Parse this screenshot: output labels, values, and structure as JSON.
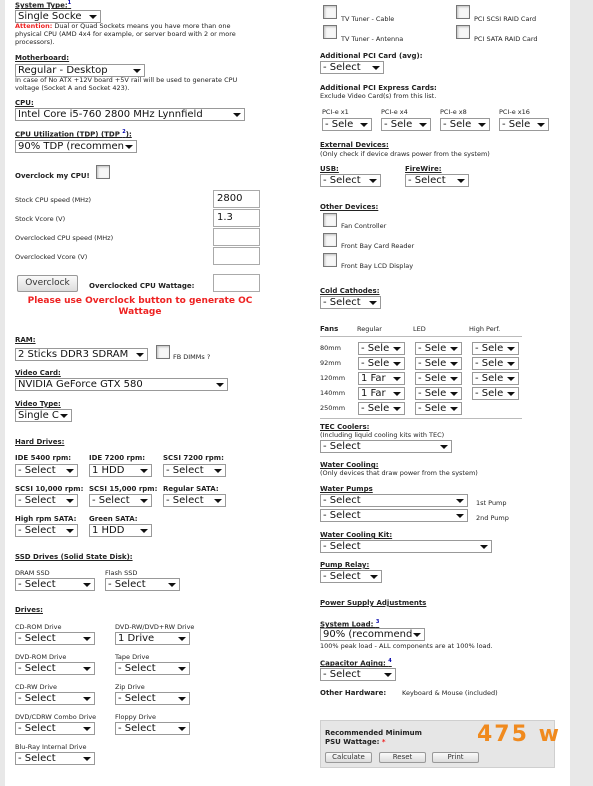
{
  "left": {
    "system_type": {
      "label": "System Type:",
      "value": "Single Socke"
    },
    "attention": {
      "prefix": "Attention:",
      "text": "Dual or Quad Sockets means you have more than one physical CPU (AMD 4x4 for example, or server board with 2 or more processors)."
    },
    "motherboard": {
      "label": "Motherboard:",
      "value": "Regular - Desktop",
      "note": "In case of No ATX +12V board +5V rail will be used to generate CPU voltage (Socket A and Socket 423)."
    },
    "cpu": {
      "label": "CPU:",
      "value": "Intel Core i5-760 2800 MHz Lynnfield"
    },
    "cpu_util": {
      "label": "CPU Utilization (TDP) (TDP ",
      "value": "90% TDP (recommen"
    },
    "overclock": {
      "label": "Overclock my CPU!"
    },
    "stock_speed": {
      "label": "Stock CPU speed (MHz)",
      "value": "2800"
    },
    "stock_vcore": {
      "label": "Stock Vcore (V)",
      "value": "1.3"
    },
    "oc_speed": {
      "label": "Overclocked CPU speed (MHz)",
      "value": ""
    },
    "oc_vcore": {
      "label": "Overclocked Vcore (V)",
      "value": ""
    },
    "oc_button": "Overclock",
    "oc_wattage": {
      "label": "Overclocked CPU Wattage:",
      "value": ""
    },
    "oc_warning": "Please use Overclock button to generate OC Wattage",
    "ram": {
      "label": "RAM:",
      "value": "2 Sticks DDR3 SDRAM",
      "fb": "FB DIMMs ?"
    },
    "video_card": {
      "label": "Video Card:",
      "value": "NVIDIA GeForce GTX 580"
    },
    "video_type": {
      "label": "Video Type:",
      "value": "Single C"
    },
    "hard_drives": {
      "label": "Hard Drives:",
      "ide5400": {
        "label": "IDE 5400 rpm:",
        "value": "- Select"
      },
      "ide7200": {
        "label": "IDE 7200 rpm:",
        "value": "1 HDD"
      },
      "scsi7200": {
        "label": "SCSI 7200 rpm:",
        "value": "- Select"
      },
      "scsi10000": {
        "label": "SCSI 10,000 rpm:",
        "value": "- Select"
      },
      "scsi15000": {
        "label": "SCSI 15,000 rpm:",
        "value": "- Select"
      },
      "regsata": {
        "label": "Regular SATA:",
        "value": "- Select"
      },
      "highsata": {
        "label": "High rpm SATA:",
        "value": "- Select"
      },
      "greensata": {
        "label": "Green SATA:",
        "value": "1 HDD"
      }
    },
    "ssd": {
      "label": "SSD Drives (Solid State Disk):",
      "dram": {
        "label": "DRAM SSD",
        "value": "- Select"
      },
      "flash": {
        "label": "Flash SSD",
        "value": "- Select"
      }
    },
    "drives": {
      "label": "Drives:",
      "cdrom": {
        "label": "CD-ROM Drive",
        "value": "- Select"
      },
      "dvdrw": {
        "label": "DVD-RW/DVD+RW Drive",
        "value": "1 Drive"
      },
      "dvdrom": {
        "label": "DVD-ROM Drive",
        "value": "- Select"
      },
      "tape": {
        "label": "Tape Drive",
        "value": "- Select"
      },
      "cdrw": {
        "label": "CD-RW Drive",
        "value": "- Select"
      },
      "zip": {
        "label": "Zip Drive",
        "value": "- Select"
      },
      "combo": {
        "label": "DVD/CDRW Combo Drive",
        "value": "- Select"
      },
      "floppy": {
        "label": "Floppy Drive",
        "value": "- Select"
      },
      "bluray": {
        "label": "Blu-Ray Internal Drive",
        "value": "- Select"
      }
    }
  },
  "right": {
    "tv_cable": "TV Tuner - Cable",
    "tv_antenna": "TV Tuner - Antenna",
    "pci_scsi_raid": "PCI SCSI RAID Card",
    "pci_sata_raid": "PCI SATA RAID Card",
    "pci": {
      "label": "Additional PCI Card (avg):",
      "value": "- Select"
    },
    "pcie": {
      "label": "Additional PCI Express Cards:",
      "note": "Exclude Video Card(s) from this list.",
      "x1": {
        "label": "PCI-e x1",
        "value": "- Sele"
      },
      "x4": {
        "label": "PCI-e x4",
        "value": "- Sele"
      },
      "x8": {
        "label": "PCI-e x8",
        "value": "- Sele"
      },
      "x16": {
        "label": "PCI-e x16",
        "value": "- Sele"
      }
    },
    "external": {
      "label": "External Devices:",
      "note": "(Only check if device draws power from the system)"
    },
    "usb": {
      "label": "USB:",
      "value": "- Select"
    },
    "firewire": {
      "label": "FireWire:",
      "value": "- Select"
    },
    "other": {
      "label": "Other Devices:",
      "fan_controller": "Fan Controller",
      "card_reader": "Front Bay Card Reader",
      "lcd": "Front Bay LCD Display"
    },
    "cold_cathodes": {
      "label": "Cold Cathodes:",
      "value": "- Select"
    },
    "fans": {
      "label": "Fans",
      "col_regular": "Regular",
      "col_led": "LED",
      "col_high": "High Perf.",
      "rows": [
        {
          "size": "80mm",
          "regular": "- Sele",
          "led": "- Sele",
          "high": "- Sele"
        },
        {
          "size": "92mm",
          "regular": "- Sele",
          "led": "- Sele",
          "high": "- Sele"
        },
        {
          "size": "120mm",
          "regular": "1 Far",
          "led": "- Sele",
          "high": "- Sele"
        },
        {
          "size": "140mm",
          "regular": "1 Far",
          "led": "- Sele",
          "high": "- Sele"
        },
        {
          "size": "250mm",
          "regular": "- Sele",
          "led": "- Sele",
          "high": ""
        }
      ]
    },
    "tec": {
      "label": "TEC Coolers:",
      "note": "(Including liquid cooling kits with TEC)",
      "value": "- Select"
    },
    "water_cooling": {
      "label": "Water Cooling:",
      "note": "(Only devices that draw power from the system)"
    },
    "water_pumps": {
      "label": "Water Pumps",
      "pump1": "- Select",
      "pump1_label": "1st Pump",
      "pump2": "- Select",
      "pump2_label": "2nd Pump"
    },
    "wc_kit": {
      "label": "Water Cooling Kit:",
      "value": "- Select"
    },
    "pump_relay": {
      "label": "Pump Relay:",
      "value": "- Select"
    },
    "psu_adjust": "Power Supply Adjustments",
    "system_load": {
      "label": "System Load: ",
      "sup": "3",
      "value": "90% (recommend",
      "note": "100% peak load - ALL components are at 100% load."
    },
    "cap_aging": {
      "label": "Capacitor Aging: ",
      "sup": "4",
      "value": "- Select"
    },
    "other_hw": {
      "label": "Other Hardware:",
      "value": "Keyboard & Mouse (included)"
    },
    "recommended": {
      "line1": "Recommended Minimum",
      "line2": "PSU Wattage:",
      "mark": "*",
      "value": "475 w"
    },
    "buttons": {
      "calculate": "Calculate",
      "reset": "Reset",
      "print": "Print"
    }
  },
  "colors": {
    "accent": "#f08a1e",
    "warning": "#e22222",
    "sup": "#0000aa"
  }
}
